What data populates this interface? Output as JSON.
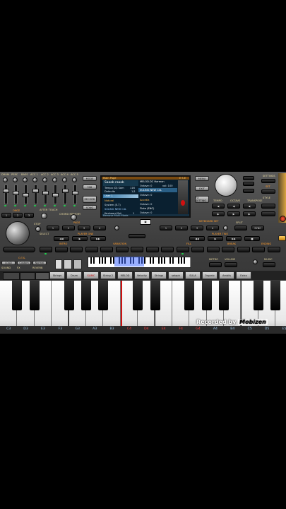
{
  "panel": {
    "mixer_labels": [
      "DRUM",
      "PERC",
      "BASS",
      "ACC 1",
      "ACC 2",
      "ACC 3",
      "ACC 4",
      "ACC 5"
    ],
    "once_label": "ONCE",
    "after_touch": "AFTER TOUCH",
    "chord_memory": "CHORD MEMORY",
    "stop_label": "STOP",
    "pads_label": "PADS",
    "player_one": "PLAYER ONE",
    "player_two": "PLAYER TWO",
    "keyboard_set": "KEYBOARD SET",
    "select_label": "SELECT",
    "intro_label": "INTRO",
    "variation_label": "VARIATION",
    "fill_label": "FILL",
    "break_label": "BREAK",
    "ending_label": "ENDING",
    "ots_label": "O.T.S.",
    "load_label": "LOAD",
    "custom_label": "Custom",
    "normal_label": "Normal",
    "sound_label": "SOUND",
    "fx_label": "FX",
    "reverb_label": "REVERB",
    "menu_label": "MENU",
    "exit_label": "EXIT",
    "fx_setting": "FX SETTING",
    "mode_label": "MODE",
    "tab_label": "TAB",
    "record_label": "RECORD",
    "song_label": "SONG",
    "tempo_label": "TEMPO",
    "octave_label": "OCTAVE",
    "transpose_label": "TRANSPOSE",
    "style_label": "STYLE",
    "set_label": "SET",
    "split_label": "SPLIT",
    "sync_label": "SYNC",
    "start_stop": "START/STOP",
    "metro_label": "METRO",
    "volume_label": "VOLUME",
    "music_label": "MUSIC",
    "settings_label": "SETTINGS"
  },
  "lcd": {
    "header": "Main Page",
    "header_right": "E  S  E",
    "style_name": "Saaab raaab",
    "tempo_row": "Tempo (D) Sam",
    "tempo_value": "116",
    "beat_row": "Defaults",
    "beat_value": "1/1",
    "user_row": "User 1",
    "style_row": "Natural",
    "vol_row": "System (E-T)",
    "kb_row": "Keyboard Set",
    "kb_value": "1",
    "voice1_name": "MELOD.DC Harmon",
    "voice1_sub": "Octave: 0",
    "voice1_vol": "vol: 100",
    "voice2_name": "SULING NEW C4L",
    "voice3_name": "Acordia",
    "voice3_sub": "Octave: 0",
    "voice4_name": "Flute (ENC)",
    "voice4_sub": "Octave: 0",
    "footer": "Remove Mutli Mode"
  },
  "style_bar": [
    "Strings",
    "Drum",
    "SLIMC",
    "String 2",
    "MELOD",
    "Velocity",
    "Strings",
    "selaph",
    "SULA",
    "Organic",
    "Ambils",
    "Extra"
  ],
  "keyboard": {
    "notes": [
      "C3",
      "D3",
      "E3",
      "F3",
      "G3",
      "A3",
      "B3",
      "C4",
      "D4",
      "E4",
      "F4",
      "G4",
      "A4",
      "B4",
      "C5",
      "D5",
      "E5"
    ]
  },
  "watermark": {
    "prefix": "Recorded by",
    "brand": "Mobizen"
  },
  "colors": {
    "accent_orange": "#ff9a2a",
    "led_green": "#1fd14c",
    "note_blue": "#9ec7e8",
    "note_red": "#ff4040",
    "red_bar": "#d01010"
  }
}
